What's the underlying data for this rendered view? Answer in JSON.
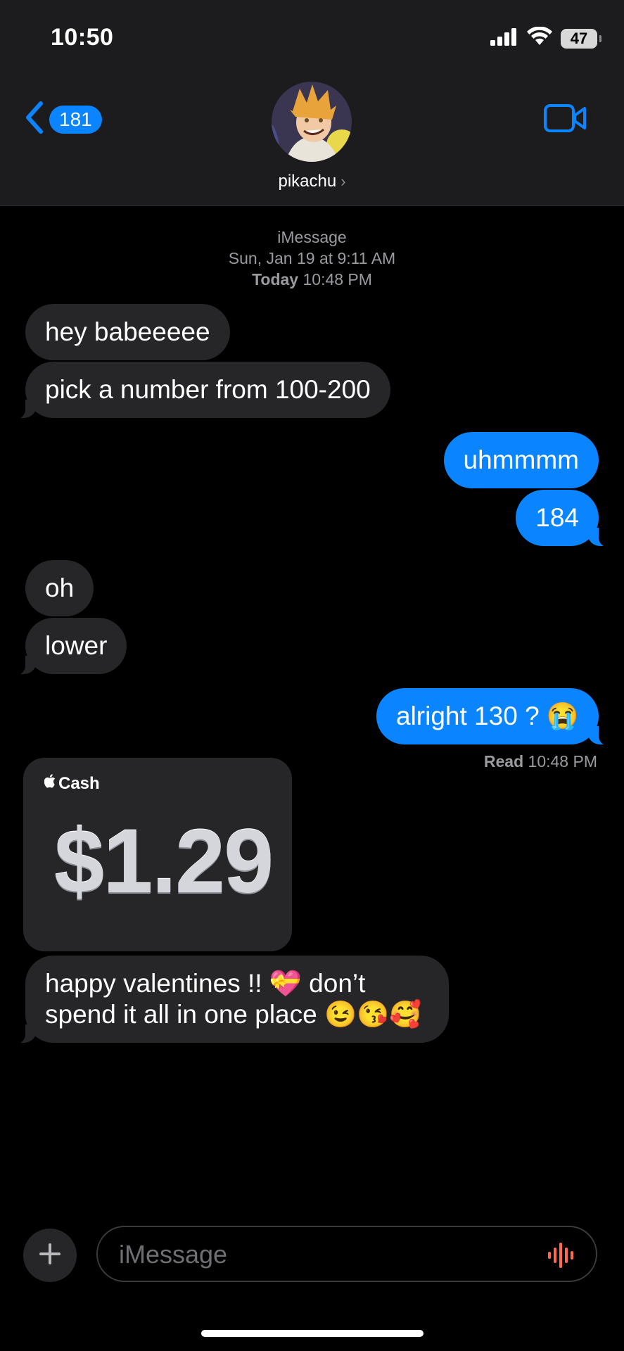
{
  "status": {
    "time": "10:50",
    "battery": "47"
  },
  "header": {
    "back_count": "181",
    "contact_name": "pikachu",
    "chevron": "›"
  },
  "meta": {
    "service": "iMessage",
    "first_date": "Sun, Jan 19 at 9:11 AM",
    "today_bold": "Today",
    "today_time": "10:48 PM"
  },
  "messages": [
    {
      "from": "them",
      "text": "hey babeeeee"
    },
    {
      "from": "them",
      "text": "pick a number from 100-200"
    },
    {
      "from": "me",
      "text": "uhmmmm"
    },
    {
      "from": "me",
      "text": "184"
    },
    {
      "from": "them",
      "text": "oh"
    },
    {
      "from": "them",
      "text": "lower"
    },
    {
      "from": "me",
      "text": "alright 130 ? 😭"
    },
    {
      "from": "them",
      "text": "happy valentines !! 💝 don’t spend it all in one place 😉😘🥰"
    }
  ],
  "read_receipt": {
    "label": "Read",
    "time": "10:48 PM"
  },
  "cash": {
    "brand": "Cash",
    "amount": "$1.29"
  },
  "compose": {
    "placeholder": "iMessage",
    "plus": "+"
  },
  "colors": {
    "accent": "#0a84ff",
    "incoming_bubble": "#262628",
    "audio": "#ff6b4a"
  },
  "icons": [
    "signal-icon",
    "wifi-icon",
    "battery-icon",
    "back-chevron-icon",
    "video-call-icon",
    "apple-logo-icon",
    "plus-icon",
    "audio-waveform-icon"
  ]
}
